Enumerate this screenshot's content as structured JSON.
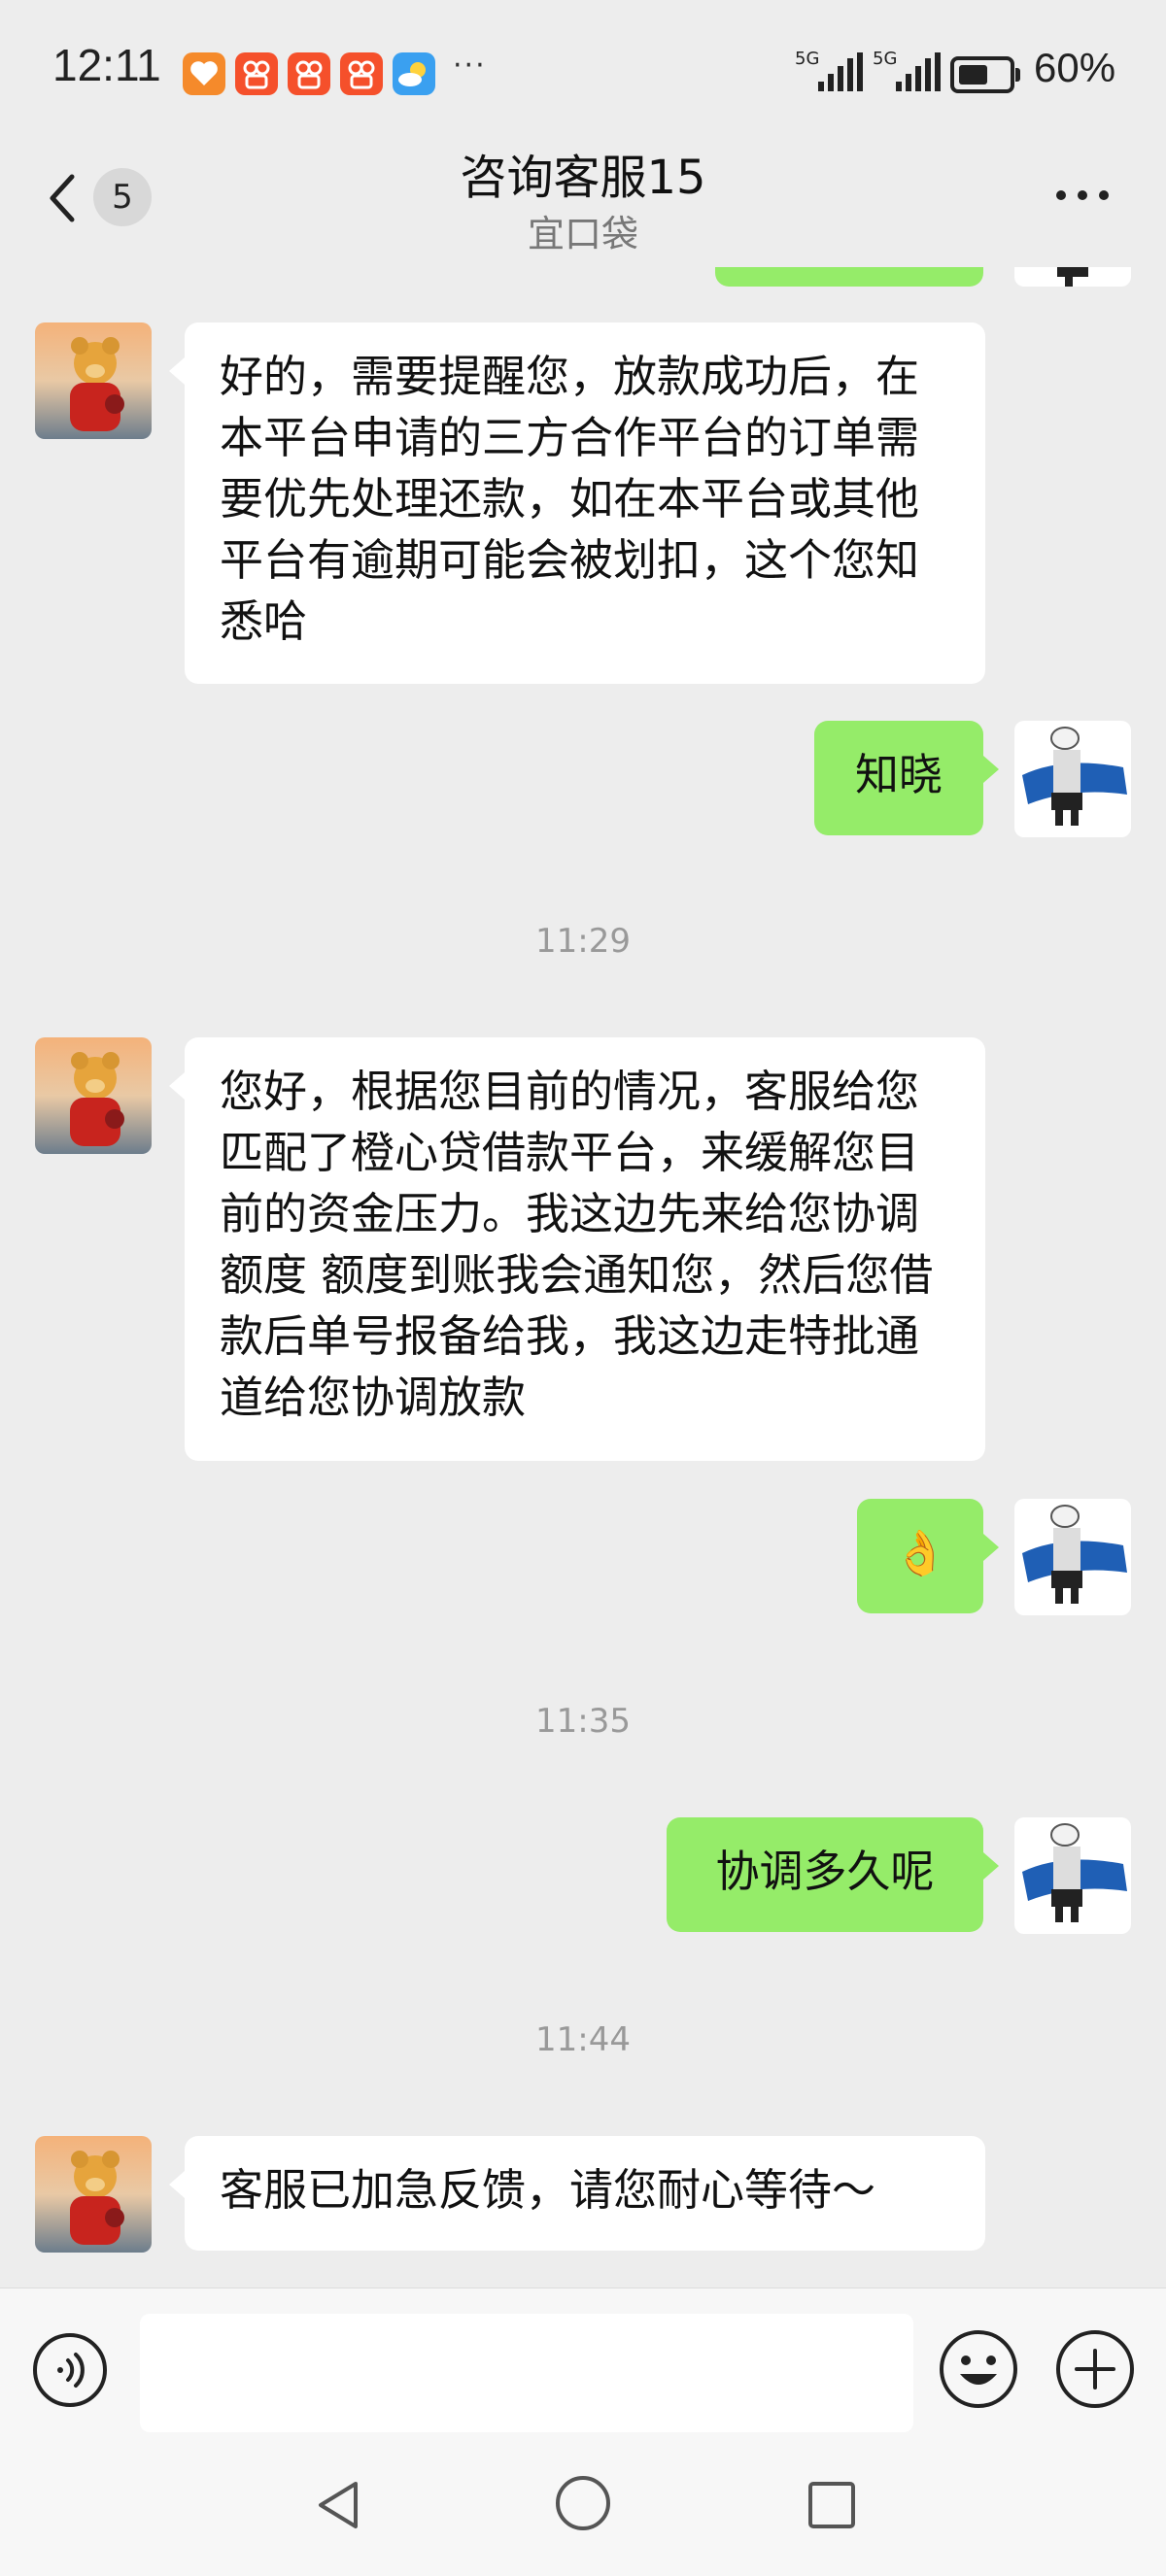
{
  "status_bar": {
    "time": "12:11",
    "signal_1": "5G",
    "signal_2": "5G",
    "battery": "60%",
    "battery_level": 0.6,
    "more_indicator": "···"
  },
  "header": {
    "unread_count": "5",
    "title": "咨询客服15",
    "subtitle": "宜口袋"
  },
  "messages": {
    "m1": "好的，需要提醒您，放款成功后，在本平台申请的三方合作平台的订单需要优先处理还款，如在本平台或其他平台有逾期可能会被划扣，这个您知悉哈",
    "m2": "知晓",
    "t1": "11:29",
    "m3": "您好，根据您目前的情况，客服给您匹配了橙心贷借款平台，来缓解您目前的资金压力。我这边先来给您协调额度 额度到账我会通知您，然后您借款后单号报备给我，我这边走特批通道给您协调放款",
    "m4": "👌",
    "t2": "11:35",
    "m5": "协调多久呢",
    "t3": "11:44",
    "m6": "客服已加急反馈，请您耐心等待～"
  },
  "icons": {
    "back": "chevron-left-icon",
    "more": "more-horizontal-icon",
    "voice": "voice-icon",
    "emoji": "emoji-icon",
    "plus": "plus-icon"
  },
  "colors": {
    "self_bubble": "#95ec69",
    "other_bubble": "#ffffff",
    "background": "#ededed"
  }
}
